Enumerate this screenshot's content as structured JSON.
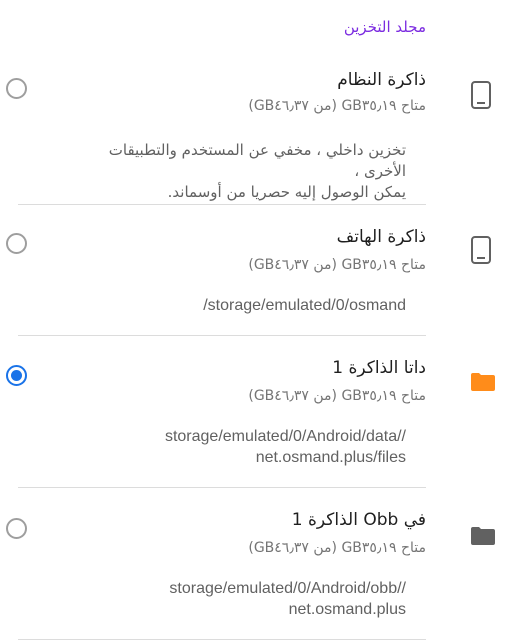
{
  "header": {
    "section_title": "مجلد التخزين"
  },
  "options": [
    {
      "title": "ذاكرة النظام",
      "subtitle": "متاح ‎GB٣٥٫١٩ (من ‎GB٤٦٫٣٧)",
      "description_line1": "تخزين داخلي ، مخفي عن المستخدم والتطبيقات الأخرى ،",
      "description_line2": "يمكن الوصول إليه حصريا من أوسماند.",
      "icon": "phone-icon",
      "selected": false
    },
    {
      "title": "ذاكرة الهاتف",
      "subtitle": "متاح ‎GB٣٥٫١٩ (من ‎GB٤٦٫٣٧)",
      "description_line1": "/storage/emulated/0/osmand",
      "description_line2": "",
      "icon": "phone-icon",
      "selected": false
    },
    {
      "title": "داتا الذاكرة 1",
      "subtitle": "متاح ‎GB٣٥٫١٩ (من ‎GB٤٦٫٣٧)",
      "description_line1": "storage/emulated/0/Android/data//",
      "description_line2": "net.osmand.plus/files",
      "icon": "folder-icon",
      "icon_color": "#ff8c1a",
      "selected": true
    },
    {
      "title": "في Obb الذاكرة 1",
      "subtitle": "متاح ‎GB٣٥٫١٩ (من ‎GB٤٦٫٣٧)",
      "description_line1": "storage/emulated/0/Android/obb//",
      "description_line2": "net.osmand.plus",
      "icon": "folder-icon",
      "icon_color": "#616161",
      "selected": false
    }
  ],
  "colors": {
    "accent": "#7b2be0",
    "radio_selected": "#1a73e8",
    "folder_orange": "#ff8c1a",
    "icon_gray": "#616161"
  }
}
